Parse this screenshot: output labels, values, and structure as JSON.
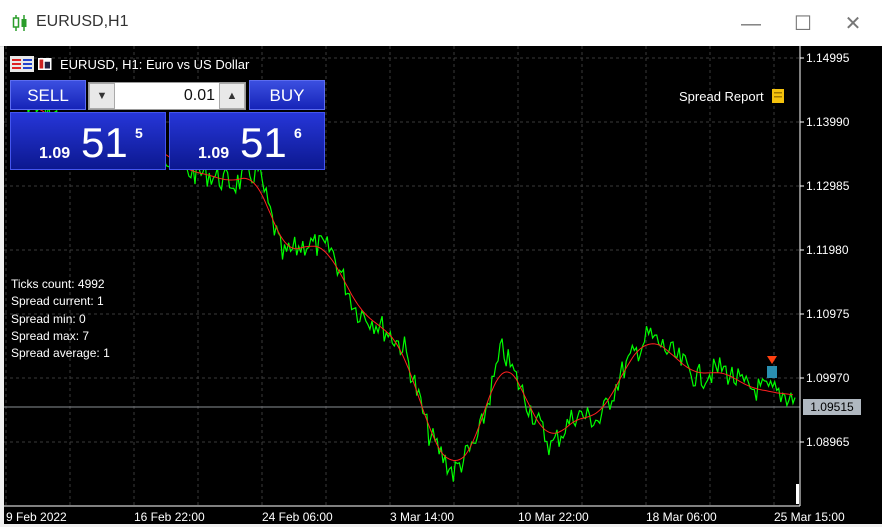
{
  "window": {
    "title": "EURUSD,H1",
    "minimize": "—",
    "maximize": "☐",
    "close": "✕"
  },
  "chart_header": {
    "symbol_desc": "EURUSD, H1:  Euro vs US Dollar"
  },
  "trade_panel": {
    "sell_label": "SELL",
    "buy_label": "BUY",
    "lot_value": "0.01",
    "sell_price": {
      "small": "1.09",
      "big": "51",
      "sup": "5"
    },
    "buy_price": {
      "small": "1.09",
      "big": "51",
      "sup": "6"
    }
  },
  "spread_report_label": "Spread Report",
  "stats": [
    "Ticks count: 4992",
    "Spread current: 1",
    "Spread min: 0",
    "Spread max: 7",
    "Spread average: 1"
  ],
  "price_axis": [
    "1.14995",
    "1.13990",
    "1.12985",
    "1.11980",
    "1.10975",
    "1.09970",
    "1.08965"
  ],
  "current_price": "1.09515",
  "time_axis": [
    "9 Feb 2022",
    "16 Feb 22:00",
    "24 Feb 06:00",
    "3 Mar 14:00",
    "10 Mar 22:00",
    "18 Mar 06:00",
    "25 Mar 15:00"
  ],
  "colors": {
    "price_line": "#00ff00",
    "ma_line": "#ff2020",
    "grid": "#3a3a3a",
    "background": "#000000"
  },
  "chart_data": {
    "type": "line",
    "series": [
      {
        "x": [
          "9 Feb",
          "10 Feb",
          "11 Feb",
          "14 Feb",
          "15 Feb",
          "16 Feb",
          "17 Feb",
          "18 Feb",
          "21 Feb",
          "22 Feb",
          "23 Feb",
          "24 Feb",
          "25 Feb",
          "28 Feb",
          "1 Mar",
          "2 Mar",
          "3 Mar",
          "4 Mar",
          "7 Mar",
          "8 Mar",
          "9 Mar",
          "10 Mar",
          "11 Mar",
          "14 Mar",
          "15 Mar",
          "16 Mar",
          "17 Mar",
          "18 Mar",
          "21 Mar",
          "22 Mar",
          "23 Mar",
          "24 Mar",
          "25 Mar"
        ],
        "values": [
          1.1435,
          1.143,
          1.1395,
          1.135,
          1.136,
          1.137,
          1.1365,
          1.133,
          1.1325,
          1.131,
          1.133,
          1.12,
          1.122,
          1.121,
          1.112,
          1.1095,
          1.106,
          1.093,
          1.087,
          1.092,
          1.106,
          1.098,
          1.091,
          1.096,
          1.095,
          1.103,
          1.108,
          1.105,
          1.1015,
          1.103,
          1.1,
          1.0995,
          1.0985
        ]
      }
    ],
    "ylim": [
      1.082,
      1.152
    ]
  }
}
